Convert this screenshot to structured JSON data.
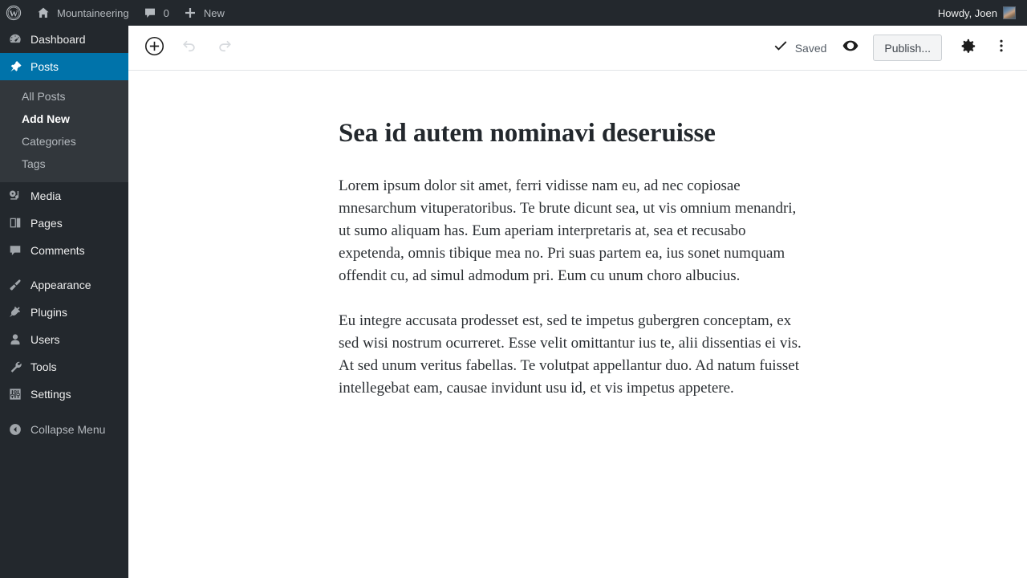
{
  "adminbar": {
    "logo_icon": "wordpress-logo-icon",
    "site": {
      "icon": "home-icon",
      "label": "Mountaineering"
    },
    "comments": {
      "icon": "comment-bubble-icon",
      "count": "0"
    },
    "new": {
      "icon": "plus-icon",
      "label": "New"
    },
    "account": {
      "greeting": "Howdy, Joen",
      "avatar_icon": "user-avatar"
    }
  },
  "sidebar": {
    "items": [
      {
        "label": "Dashboard",
        "icon": "dashboard-icon",
        "current": false
      },
      {
        "label": "Posts",
        "icon": "pin-icon",
        "current": true
      },
      {
        "label": "Media",
        "icon": "media-icon",
        "current": false
      },
      {
        "label": "Pages",
        "icon": "pages-icon",
        "current": false
      },
      {
        "label": "Comments",
        "icon": "comments-icon",
        "current": false
      },
      {
        "label": "Appearance",
        "icon": "paintbrush-icon",
        "current": false
      },
      {
        "label": "Plugins",
        "icon": "plug-icon",
        "current": false
      },
      {
        "label": "Users",
        "icon": "user-icon",
        "current": false
      },
      {
        "label": "Tools",
        "icon": "wrench-icon",
        "current": false
      },
      {
        "label": "Settings",
        "icon": "sliders-icon",
        "current": false
      }
    ],
    "submenu": [
      {
        "label": "All Posts",
        "current": false
      },
      {
        "label": "Add New",
        "current": true
      },
      {
        "label": "Categories",
        "current": false
      },
      {
        "label": "Tags",
        "current": false
      }
    ],
    "collapse": {
      "label": "Collapse Menu",
      "icon": "collapse-arrow-icon"
    },
    "accent_color": "#0073aa",
    "background_color": "#23282d",
    "submenu_background_color": "#32373c"
  },
  "editor_header": {
    "add_block_icon": "circle-plus-icon",
    "undo_icon": "undo-arrow-icon",
    "redo_icon": "redo-arrow-icon",
    "saved_label": "Saved",
    "saved_icon": "checkmark-icon",
    "preview_icon": "eye-icon",
    "publish_label": "Publish...",
    "settings_icon": "gear-icon",
    "more_icon": "more-vertical-icon"
  },
  "post": {
    "title": "Sea id autem nominavi deseruisse",
    "paragraphs": [
      "Lorem ipsum dolor sit amet, ferri vidisse nam eu, ad nec copiosae mnesarchum vituperatoribus. Te brute dicunt sea, ut vis omnium menandri, ut sumo aliquam has. Eum aperiam interpretaris at, sea et recusabo expetenda, omnis tibique mea no. Pri suas partem ea, ius sonet numquam offendit cu, ad simul admodum pri. Eum cu unum choro albucius.",
      "Eu integre accusata prodesset est, sed te impetus gubergren conceptam, ex sed wisi nostrum ocurreret. Esse velit omittantur ius te, alii dissentias ei vis. At sed unum veritus fabellas. Te volutpat appellantur duo. Ad natum fuisset intellegebat eam, causae invidunt usu id, et vis impetus appetere."
    ]
  }
}
